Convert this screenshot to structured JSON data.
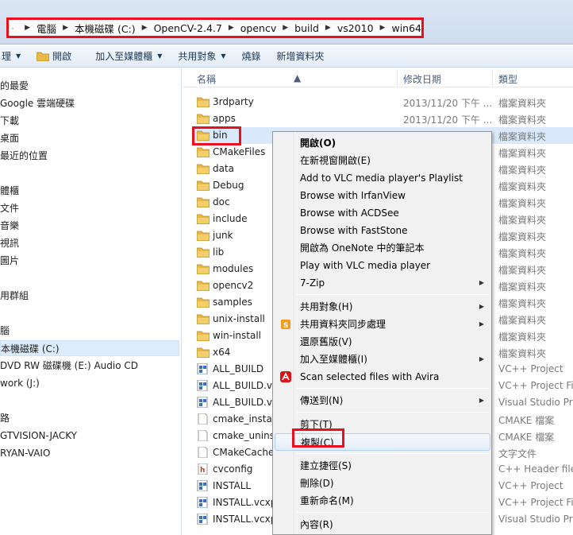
{
  "breadcrumbs": [
    "電腦",
    "本機磁碟 (C:)",
    "OpenCV-2.4.7",
    "opencv",
    "build",
    "vs2010",
    "win64"
  ],
  "toolbar": {
    "organize": "理",
    "open": "開啟",
    "add_to_library": "加入至媒體櫃",
    "share": "共用對象",
    "burn": "燒錄",
    "new_folder": "新增資料夾"
  },
  "nav": [
    "的最愛",
    "Google 雲端硬碟",
    "下載",
    "桌面",
    "最近的位置",
    "體櫃",
    "文件",
    "音樂",
    "視訊",
    "圖片",
    "用群組",
    "腦",
    "本機磁碟 (C:)",
    "DVD RW 磁碟機 (E:) Audio CD",
    "work (J:)",
    "路",
    "GTVISION-JACKY",
    "RYAN-VAIO"
  ],
  "columns": {
    "name": "名稱",
    "date": "修改日期",
    "type": "類型"
  },
  "files": [
    {
      "name": "3rdparty",
      "date": "2013/11/20 下午 ...",
      "type": "檔案資料夾",
      "icon": "folder"
    },
    {
      "name": "apps",
      "date": "2013/11/20 下午 ...",
      "type": "檔案資料夾",
      "icon": "folder"
    },
    {
      "name": "bin",
      "date": "",
      "type": "檔案資料夾",
      "icon": "folder"
    },
    {
      "name": "CMakeFiles",
      "date": "",
      "type": "檔案資料夾",
      "icon": "folder"
    },
    {
      "name": "data",
      "date": "",
      "type": "檔案資料夾",
      "icon": "folder"
    },
    {
      "name": "Debug",
      "date": "",
      "type": "檔案資料夾",
      "icon": "folder"
    },
    {
      "name": "doc",
      "date": "",
      "type": "檔案資料夾",
      "icon": "folder"
    },
    {
      "name": "include",
      "date": "",
      "type": "檔案資料夾",
      "icon": "folder"
    },
    {
      "name": "junk",
      "date": "",
      "type": "檔案資料夾",
      "icon": "folder"
    },
    {
      "name": "lib",
      "date": "",
      "type": "檔案資料夾",
      "icon": "folder"
    },
    {
      "name": "modules",
      "date": "",
      "type": "檔案資料夾",
      "icon": "folder"
    },
    {
      "name": "opencv2",
      "date": "",
      "type": "檔案資料夾",
      "icon": "folder"
    },
    {
      "name": "samples",
      "date": "",
      "type": "檔案資料夾",
      "icon": "folder"
    },
    {
      "name": "unix-install",
      "date": "",
      "type": "檔案資料夾",
      "icon": "folder"
    },
    {
      "name": "win-install",
      "date": "",
      "type": "檔案資料夾",
      "icon": "folder"
    },
    {
      "name": "x64",
      "date": "",
      "type": "檔案資料夾",
      "icon": "folder"
    },
    {
      "name": "ALL_BUILD",
      "date": "",
      "type": "VC++ Project",
      "icon": "vcproj"
    },
    {
      "name": "ALL_BUILD.vcx",
      "date": "",
      "type": "VC++ Project Filt",
      "icon": "vcproj"
    },
    {
      "name": "ALL_BUILD.vcx",
      "date": "",
      "type": "Visual Studio Pro",
      "icon": "vcproj"
    },
    {
      "name": "cmake_install",
      "date": "",
      "type": "CMAKE 檔案",
      "icon": "doc"
    },
    {
      "name": "cmake_uninst",
      "date": "",
      "type": "CMAKE 檔案",
      "icon": "doc"
    },
    {
      "name": "CMakeCache",
      "date": "",
      "type": "文字文件",
      "icon": "doc"
    },
    {
      "name": "cvconfig",
      "date": "",
      "type": "C++ Header file",
      "icon": "header"
    },
    {
      "name": "INSTALL",
      "date": "",
      "type": "VC++ Project",
      "icon": "vcproj"
    },
    {
      "name": "INSTALL.vcxp",
      "date": "",
      "type": "VC++ Project Filt",
      "icon": "vcproj"
    },
    {
      "name": "INSTALL.vcxp",
      "date": "",
      "type": "Visual Studio Pro",
      "icon": "vcproj"
    }
  ],
  "context_menu": [
    {
      "label": "開啟(O)",
      "bold": true
    },
    {
      "label": "在新視窗開啟(E)"
    },
    {
      "label": "Add to VLC media player's Playlist"
    },
    {
      "label": "Browse with IrfanView"
    },
    {
      "label": "Browse with ACDSee"
    },
    {
      "label": "Browse with FastStone"
    },
    {
      "label": "開啟為 OneNote 中的筆記本"
    },
    {
      "label": "Play with VLC media player"
    },
    {
      "label": "7-Zip",
      "submenu": true
    },
    {
      "sep": true
    },
    {
      "label": "共用對象(H)",
      "submenu": true
    },
    {
      "label": "共用資料夾同步處理",
      "submenu": true,
      "icon": "sync-icon"
    },
    {
      "label": "還原舊版(V)"
    },
    {
      "label": "加入至媒體櫃(I)",
      "submenu": true
    },
    {
      "label": "Scan selected files with Avira",
      "icon": "avira-icon"
    },
    {
      "sep": true
    },
    {
      "label": "傳送到(N)",
      "submenu": true
    },
    {
      "sep": true
    },
    {
      "label": "剪下(T)"
    },
    {
      "label": "複製(C)",
      "hover": true
    },
    {
      "sep": true
    },
    {
      "label": "建立捷徑(S)"
    },
    {
      "label": "刪除(D)"
    },
    {
      "label": "重新命名(M)"
    },
    {
      "sep": true
    },
    {
      "label": "內容(R)"
    }
  ],
  "colors": {
    "highlight_red": "#e8101f",
    "folder": "#e6b94a",
    "selection": "#d9e9fb"
  }
}
